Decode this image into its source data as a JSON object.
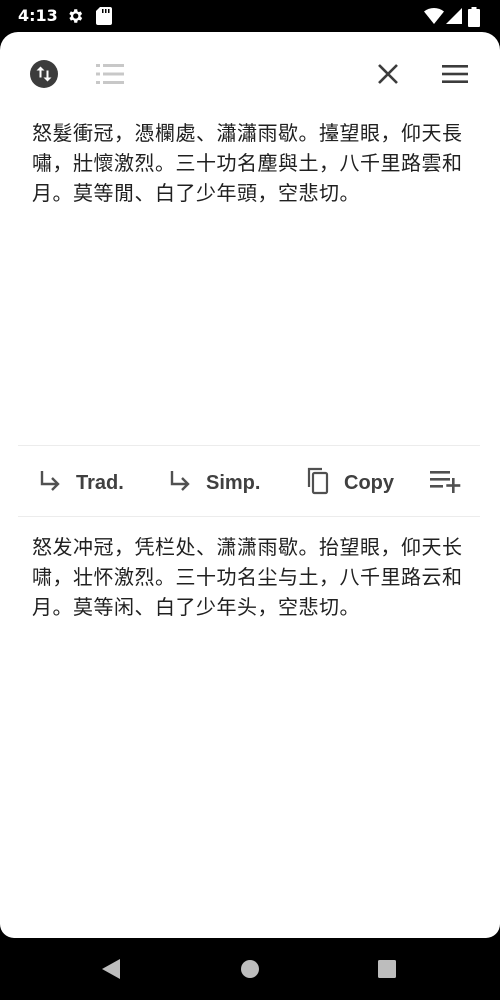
{
  "status": {
    "time": "4:13",
    "icons": [
      "gear-icon",
      "sd-card-icon",
      "wifi-icon",
      "signal-icon",
      "battery-icon"
    ]
  },
  "toolbar": {
    "icons": [
      "swap-icon",
      "list-icon",
      "close-icon",
      "menu-icon"
    ]
  },
  "source_text": "怒髮衝冠，憑欄處、瀟瀟雨歇。擡望眼，仰天長嘯，壯懷激烈。三十功名塵與土，八千里路雲和月。莫等閒、白了少年頭，空悲切。",
  "actions": {
    "trad_label": "Trad.",
    "simp_label": "Simp.",
    "copy_label": "Copy",
    "playlist_add_icon": "playlist-add-icon"
  },
  "result_text": "怒发冲冠，凭栏处、潇潇雨歇。抬望眼，仰天长啸，壮怀激烈。三十功名尘与土，八千里路云和月。莫等闲、白了少年头，空悲切。",
  "navigation": {
    "icons": [
      "back-icon",
      "home-icon",
      "recents-icon"
    ]
  },
  "colors": {
    "icon_dark": "#3c3c3c",
    "icon_muted": "#c8c8c8",
    "text": "#202020"
  }
}
